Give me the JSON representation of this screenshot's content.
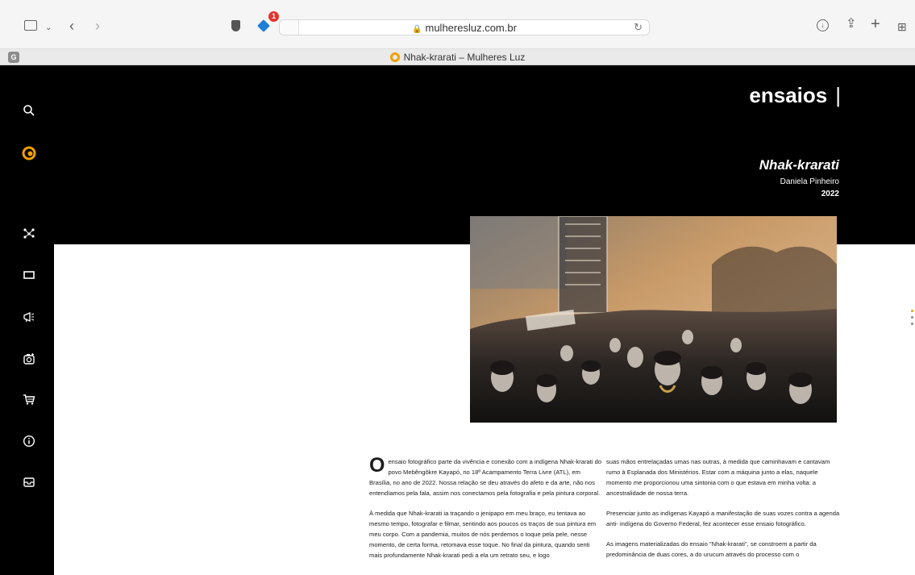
{
  "browser": {
    "url": "mulheresluz.com.br",
    "extension_badge": "1",
    "tab_title": "Nhak-krarati – Mulheres Luz",
    "tab_group_letter": "G"
  },
  "site": {
    "section_title": "ensaios",
    "title_bar_glyph": "|",
    "accent_color": "#f0a000"
  },
  "sidebar": {
    "items": [
      {
        "name": "search-icon",
        "glyph": "⌕"
      },
      {
        "name": "logo-icon",
        "glyph": ""
      },
      {
        "name": "network-icon",
        "glyph": "⁂"
      },
      {
        "name": "gallery-icon",
        "glyph": "▭"
      },
      {
        "name": "megaphone-icon",
        "glyph": "📢"
      },
      {
        "name": "camera-icon",
        "glyph": "⊙"
      },
      {
        "name": "cart-icon",
        "glyph": "🛒"
      },
      {
        "name": "info-icon",
        "glyph": "ⓘ"
      },
      {
        "name": "mail-icon",
        "glyph": "✉"
      }
    ]
  },
  "essay": {
    "title": "Nhak-krarati",
    "author": "Daniela Pinheiro",
    "year": "2022",
    "dropcap": "O",
    "left_column": [
      "ensaio fotográfico parte da vivência e conexão com a indígena Nhak-krarati do povo Mebêngôkre Kayapó, no 18º Acampamento Terra Livre (ATL), em Brasília, no ano de 2022. Nossa relação se deu através do afeto e da arte, não nos entendíamos pela fala, assim nos conectamos pela fotografia e pela pintura corporal.",
      "À medida que Nhak-krarati ia traçando o jenipapo em meu braço, eu tentava ao mesmo tempo, fotografar e filmar, sentindo aos poucos os traços de sua pintura em meu corpo. Com a pandemia, muitos de nós perdemos o toque pela pele, nesse momento, de certa forma, retomava esse toque. No final da pintura, quando senti mais profundamente Nhak-krarati pedi a ela um retrato seu, e logo"
    ],
    "right_column": [
      "suas mãos entrelaçadas umas nas outras, à medida que caminhavam e cantavam rumo à Esplanada dos Ministérios. Estar com a máquina junto a elas, naquele momento me proporcionou uma sintonia com o que estava em minha volta: a ancestralidade de nossa terra.",
      "Presenciar junto as indígenas Kayapó a manifestação de suas vozes contra a agenda anti- indígena do Governo Federal, fez acontecer  esse ensaio fotográfico.",
      "As imagens materializadas do ensaio \"Nhak-krarati\", se constroem a partir da predominância de duas cores, a do urucum através do processo com o"
    ]
  }
}
